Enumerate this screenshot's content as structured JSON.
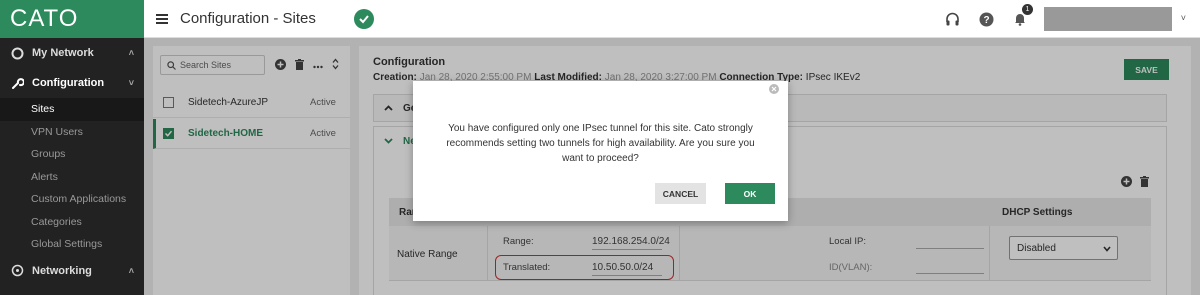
{
  "app": {
    "logo": "CATO",
    "page_title": "Configuration - Sites",
    "notification_count": "1",
    "accent_color": "#2c8a5c"
  },
  "sidebar": {
    "sections": [
      {
        "label": "My Network",
        "icon": "circle-icon"
      },
      {
        "label": "Configuration",
        "icon": "wrench-icon"
      },
      {
        "label": "Networking",
        "icon": "network-icon"
      }
    ],
    "config_items": [
      {
        "label": "Sites"
      },
      {
        "label": "VPN Users"
      },
      {
        "label": "Groups"
      },
      {
        "label": "Alerts"
      },
      {
        "label": "Custom Applications"
      },
      {
        "label": "Categories"
      },
      {
        "label": "Global Settings"
      }
    ]
  },
  "sites_panel": {
    "search_placeholder": "Search Sites",
    "sites": [
      {
        "name": "Sidetech-AzureJP",
        "status": "Active",
        "checked": false
      },
      {
        "name": "Sidetech-HOME",
        "status": "Active",
        "checked": true
      }
    ]
  },
  "config": {
    "title": "Configuration",
    "creation_label": "Creation:",
    "creation_value": "Jan 28, 2020 2:55:00 PM",
    "modified_label": "Last Modified:",
    "modified_value": "Jan 28, 2020 3:27:00 PM",
    "connection_label": "Connection Type:",
    "connection_value": "IPsec IKEv2",
    "save_label": "SAVE",
    "section_1": "General",
    "section_2": "Networks",
    "table": {
      "col_range": "Range",
      "col_dhcp": "DHCP Settings",
      "row_name": "Native Range",
      "range_label": "Range:",
      "range_value": "192.168.254.0/24",
      "translated_label": "Translated:",
      "translated_value": "10.50.50.0/24",
      "local_ip_label": "Local IP:",
      "vlan_label": "ID(VLAN):",
      "dhcp_value": "Disabled"
    }
  },
  "modal": {
    "message": "You have configured only one IPsec tunnel for this site. Cato strongly recommends setting two tunnels for high availability. Are you sure you want to proceed?",
    "cancel_label": "CANCEL",
    "ok_label": "OK"
  }
}
